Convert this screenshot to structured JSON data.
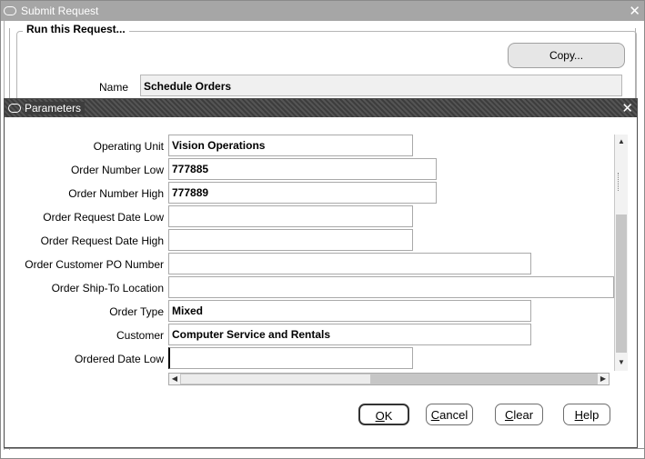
{
  "outer_window": {
    "title": "Submit Request",
    "close_glyph": "✕"
  },
  "run_section": {
    "legend": "Run this Request...",
    "copy_label": "Copy...",
    "name_label": "Name",
    "name_value": "Schedule Orders"
  },
  "params_window": {
    "title": "Parameters",
    "close_glyph": "✕",
    "fields": [
      {
        "label": "Operating Unit",
        "value": "Vision Operations"
      },
      {
        "label": "Order Number Low",
        "value": "777885"
      },
      {
        "label": "Order Number High",
        "value": "777889"
      },
      {
        "label": "Order Request Date Low",
        "value": ""
      },
      {
        "label": "Order Request Date High",
        "value": ""
      },
      {
        "label": "Order Customer PO Number",
        "value": ""
      },
      {
        "label": "Order Ship-To Location",
        "value": ""
      },
      {
        "label": "Order Type",
        "value": "Mixed"
      },
      {
        "label": "Customer",
        "value": "Computer Service and Rentals"
      },
      {
        "label": "Ordered Date Low",
        "value": ""
      }
    ]
  },
  "buttons": {
    "ok": {
      "mnemonic": "O",
      "rest": "K"
    },
    "cancel": {
      "mnemonic": "C",
      "rest": "ancel"
    },
    "clear": {
      "mnemonic": "C",
      "rest": "lear"
    },
    "help": {
      "mnemonic": "H",
      "rest": "elp"
    }
  },
  "icons": {
    "window": "window-icon",
    "scroll_up": "▲",
    "scroll_down": "▼",
    "scroll_left": "◀",
    "scroll_right": "▶"
  }
}
